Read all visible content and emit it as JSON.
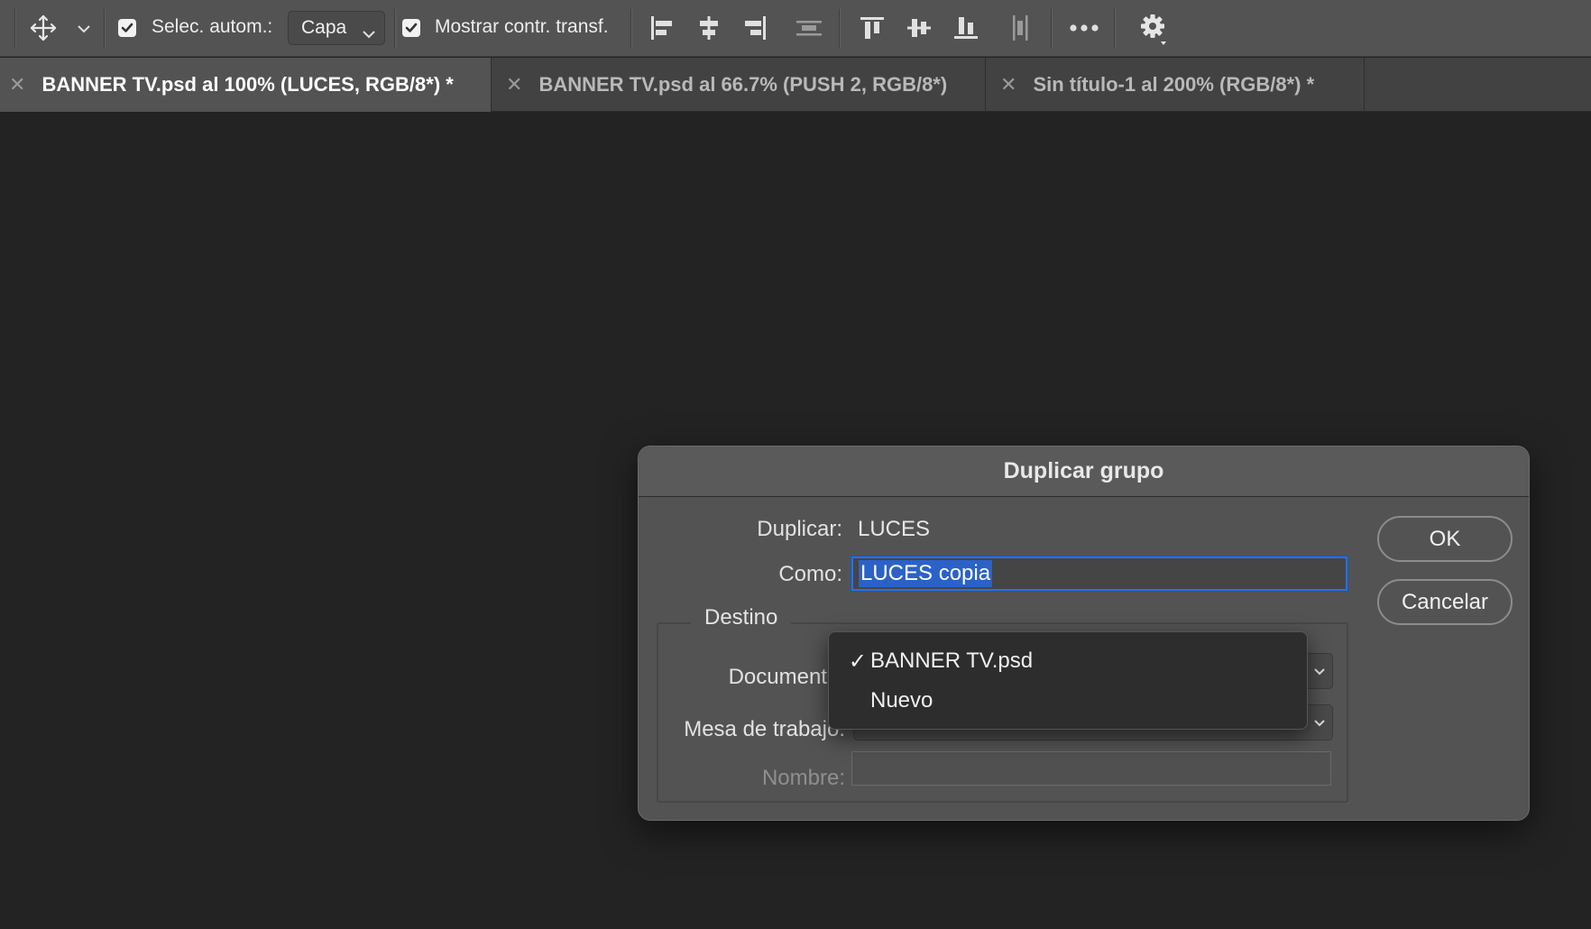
{
  "toolbar": {
    "auto_select_label": "Selec. autom.:",
    "auto_select_checked": true,
    "layer_select_value": "Capa",
    "show_transform_label": "Mostrar contr. transf.",
    "show_transform_checked": true,
    "icons": [
      "move-tool-icon",
      "chevron-down-icon",
      "align-left-icon",
      "align-horizontal-center-icon",
      "align-right-icon",
      "distribute-horizontal-icon",
      "align-top-icon",
      "align-vertical-center-icon",
      "align-bottom-icon",
      "distribute-vertical-icon",
      "more-icon",
      "gear-icon"
    ]
  },
  "tabs": [
    {
      "label": "BANNER TV.psd al 100% (LUCES, RGB/8*) *",
      "active": true
    },
    {
      "label": "BANNER TV.psd al 66.7% (PUSH 2, RGB/8*)",
      "active": false
    },
    {
      "label": "Sin título-1 al 200% (RGB/8*) *",
      "active": false
    }
  ],
  "dialog": {
    "title": "Duplicar grupo",
    "duplicate_label": "Duplicar:",
    "duplicate_value": "LUCES",
    "as_label": "Como:",
    "as_value": "LUCES copia",
    "ok_label": "OK",
    "cancel_label": "Cancelar",
    "destination": {
      "legend": "Destino",
      "document_label": "Documento:",
      "artboard_label": "Mesa de trabajo:",
      "name_label": "Nombre:",
      "name_value": ""
    }
  },
  "dropdown": {
    "items": [
      {
        "label": "BANNER TV.psd",
        "checked": true,
        "check_mark": "✓"
      },
      {
        "label": "Nuevo",
        "checked": false,
        "check_mark": ""
      }
    ]
  },
  "colors": {
    "app_bg": "#232323",
    "panel": "#535353",
    "accent": "#2b62c8"
  }
}
